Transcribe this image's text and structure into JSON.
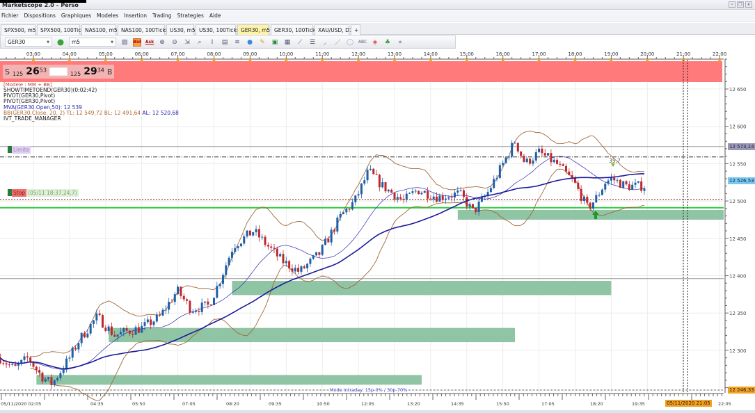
{
  "window": {
    "title": "Marketscope 2.0 – Perso",
    "controls": [
      "minimize",
      "restore",
      "close"
    ]
  },
  "menu": [
    "Fichier",
    "Dispositions",
    "Graphiques",
    "Modeles",
    "Insertion",
    "Trading",
    "Strategies",
    "Aide"
  ],
  "tabs": [
    {
      "label": "SPX500, m5"
    },
    {
      "label": "SPX500, 100Ticks"
    },
    {
      "label": "NAS100, m5"
    },
    {
      "label": "NAS100, 100Ticks"
    },
    {
      "label": "US30, m5"
    },
    {
      "label": "US30, 100Ticks"
    },
    {
      "label": "GER30, m5",
      "active": true,
      "close": "×"
    },
    {
      "label": "GER30, 100Ticks"
    },
    {
      "label": "XAU/USD, D1"
    }
  ],
  "tab_add": "+",
  "toolbar": {
    "instrument": "GER30",
    "timeframe": "m5",
    "bid_label": "Bid",
    "ask_label": "Ask",
    "icons": [
      "chart-type-icon",
      "bid-icon",
      "ask-icon",
      "zoom-in-icon",
      "zoom-out-icon",
      "zoom-fit-icon",
      "zoom-area-icon",
      "cursor-icon",
      "indicator-icon",
      "signal-icon",
      "globe-icon",
      "pencil-icon",
      "image-icon",
      "screenshot-icon",
      "fibonacci-icon",
      "lines-icon",
      "pen-icon",
      "line-icon",
      "ellipse-icon",
      "text-icon",
      "eraser-icon",
      "hierarchy-icon",
      "more-icon"
    ]
  },
  "quote": {
    "sell_label": "S",
    "sell_lot": "125",
    "sell_big": "26",
    "sell_pips": "53",
    "buy_lot": "125",
    "buy_big": "29",
    "buy_pips": "34",
    "buy_label": "B"
  },
  "legend": {
    "model": "[Modele : MM + BB]",
    "lines": [
      "SHOWTIMETOEND(GER30)(0:02:42)",
      "PIVOT(GER30,Pivot)",
      "PIVOT(GER30,Pivot)"
    ],
    "mva": "MVA(GER30.Open,50): 12 539",
    "bb": "BB(GER30.Close, 20, 2)",
    "bb_tl": "TL: 12 549,72",
    "bb_bl": "BL: 12 491,64",
    "bb_al": "AL: 12 520,68",
    "trade_manager": "IVT_TRADE_MANAGER"
  },
  "orders": {
    "limit_label": "Limite",
    "stop_label": "Stop",
    "stop_info": "(05/11 18:37,24,7)",
    "signal_value": "35,7"
  },
  "mode_text": "Mode Intraday: 15p-0% / 30p-70%",
  "price_tags": {
    "limit": "12 573,14",
    "current": "12 526,53",
    "bottom": "12 246,33"
  },
  "time_tag": "05/11/2020 21:05",
  "colors": {
    "bull": "#1f5fa8",
    "bear": "#c0272d",
    "ma": "#1a1a9a",
    "bb": "#a0663a",
    "zone": "#8fc4a4",
    "support": "#2ecc40",
    "session_band": "#ff7b7b"
  },
  "chart_data": {
    "type": "candlestick",
    "instrument": "GER30",
    "timeframe": "m5",
    "ylim": [
      12240,
      12700
    ],
    "yticks": [
      "12 650",
      "12 600",
      "12 550",
      "12 500",
      "12 450",
      "12 400",
      "12 350",
      "12 300"
    ],
    "ytick_values": [
      12650,
      12600,
      12550,
      12500,
      12450,
      12400,
      12350,
      12300
    ],
    "top_time_ticks": [
      "03:00",
      "04:00",
      "05:00",
      "06:00",
      "07:00",
      "08:00",
      "09:00",
      "10:00",
      "11:00",
      "12:00",
      "13:00",
      "14:00",
      "15:00",
      "16:00",
      "17:00",
      "18:00",
      "19:00",
      "20:00",
      "21:00",
      "22:00"
    ],
    "bottom_time_ticks": [
      "05/11/2020 02:05",
      "04:35",
      "05:50",
      "07:05",
      "08:20",
      "09:35",
      "10:50",
      "12:05",
      "13:20",
      "14:35",
      "15:50",
      "17:05",
      "18:20",
      "19:35",
      "22:05"
    ],
    "close_path": [
      [
        "02:05",
        12290
      ],
      [
        "02:28",
        12275
      ],
      [
        "02:51",
        12290
      ],
      [
        "03:14",
        12265
      ],
      [
        "03:31",
        12255
      ],
      [
        "04:00",
        12290
      ],
      [
        "04:17",
        12315
      ],
      [
        "04:46",
        12345
      ],
      [
        "05:15",
        12320
      ],
      [
        "05:33",
        12325
      ],
      [
        "06:00",
        12330
      ],
      [
        "06:30",
        12345
      ],
      [
        "06:59",
        12380
      ],
      [
        "07:22",
        12355
      ],
      [
        "07:51",
        12360
      ],
      [
        "08:08",
        12390
      ],
      [
        "08:32",
        12440
      ],
      [
        "09:06",
        12460
      ],
      [
        "09:29",
        12440
      ],
      [
        "09:53",
        12420
      ],
      [
        "10:22",
        12405
      ],
      [
        "10:56",
        12430
      ],
      [
        "11:31",
        12480
      ],
      [
        "11:54",
        12500
      ],
      [
        "12:17",
        12540
      ],
      [
        "12:40",
        12520
      ],
      [
        "13:15",
        12500
      ],
      [
        "13:38",
        12515
      ],
      [
        "14:13",
        12505
      ],
      [
        "14:48",
        12510
      ],
      [
        "15:11",
        12485
      ],
      [
        "15:34",
        12510
      ],
      [
        "15:57",
        12545
      ],
      [
        "16:20",
        12580
      ],
      [
        "16:37",
        12550
      ],
      [
        "17:00",
        12565
      ],
      [
        "17:29",
        12550
      ],
      [
        "17:58",
        12525
      ],
      [
        "18:21",
        12490
      ],
      [
        "18:36",
        12505
      ],
      [
        "18:50",
        12525
      ],
      [
        "19:01",
        12530
      ],
      [
        "19:24",
        12520
      ],
      [
        "19:55",
        12520
      ]
    ],
    "indicators": {
      "mva_period": 50,
      "bb_period": 20,
      "bb_dev": 2
    },
    "levels": {
      "limit": 12573,
      "dashdot": 12559,
      "pivot": 12502,
      "support": 12491,
      "gray": 12396
    },
    "zones": [
      {
        "from": "14:45",
        "to": "22:10",
        "top": 12488,
        "bottom": 12475
      },
      {
        "from": "08:30",
        "to": "19:00",
        "top": 12393,
        "bottom": 12374
      },
      {
        "from": "05:05",
        "to": "16:20",
        "top": 12330,
        "bottom": 12311
      },
      {
        "from": "03:05",
        "to": "13:45",
        "top": 12267,
        "bottom": 12254
      }
    ]
  }
}
